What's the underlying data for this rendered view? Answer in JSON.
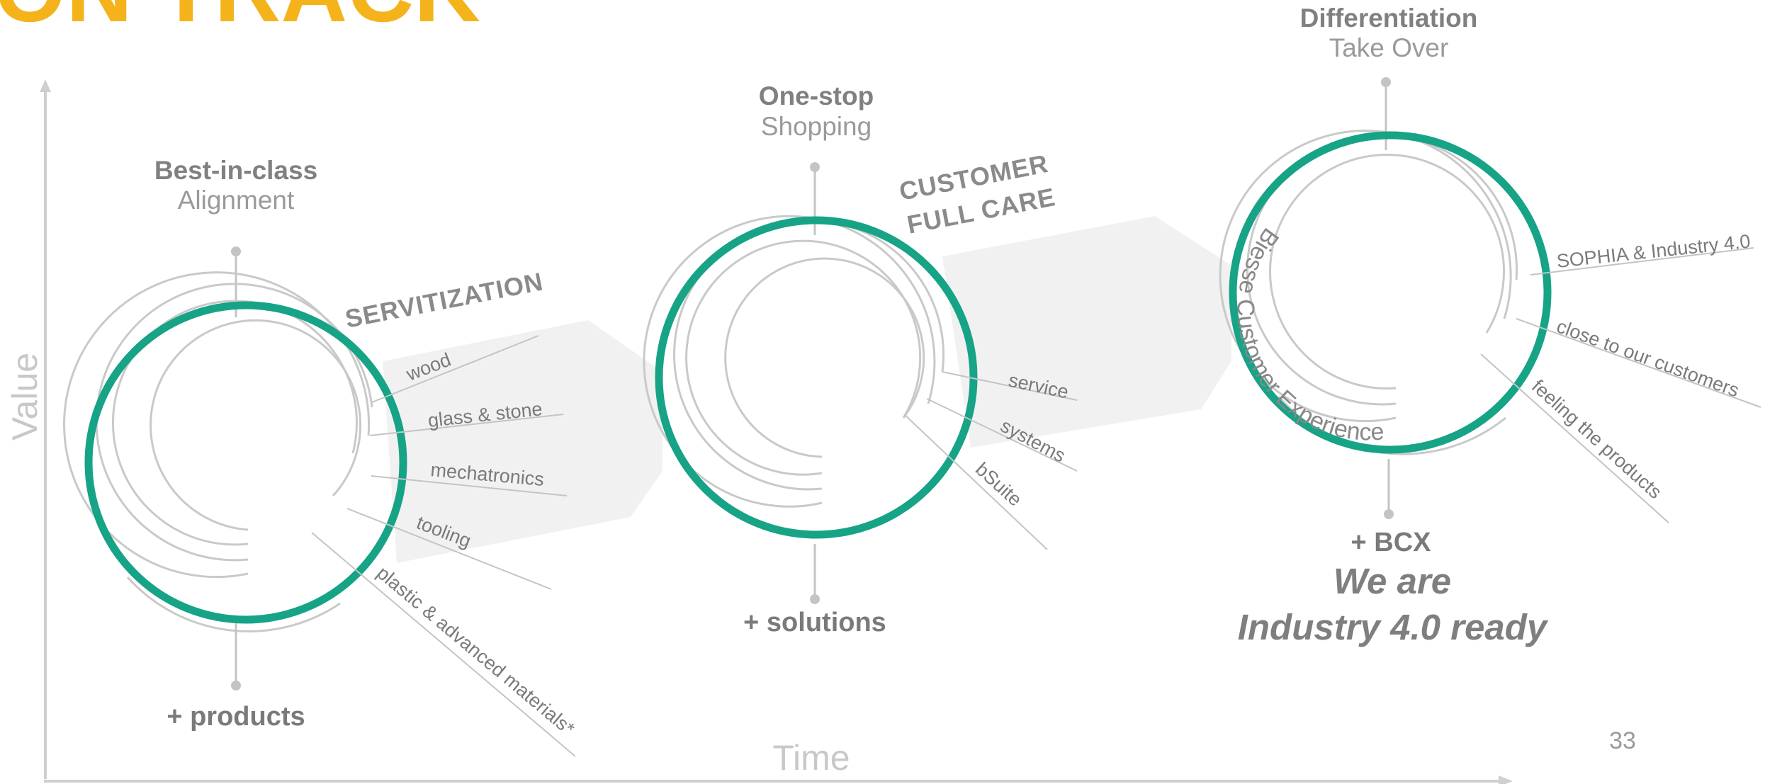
{
  "title": "ON TRACK",
  "axes": {
    "y_label": "Value",
    "x_label": "Time"
  },
  "page_number": "33",
  "colors": {
    "ring": "#17a385",
    "accent": "#f5b31b",
    "text": "#808080",
    "band": "#f0f0f0"
  },
  "stages": [
    {
      "top_bold": "Best-in-class",
      "top_light": "Alignment",
      "bottom": "+ products",
      "tag_line1": "SERVITIZATION",
      "tag_line2": "",
      "branches": [
        "wood",
        "glass & stone",
        "mechatronics",
        "tooling",
        "plastic & advanced materials*"
      ]
    },
    {
      "top_bold": "One-stop",
      "top_light": "Shopping",
      "bottom": "+ solutions",
      "tag_line1": "CUSTOMER",
      "tag_line2": "FULL CARE",
      "branches": [
        "service",
        "systems",
        "bSuite"
      ]
    },
    {
      "top_bold": "Differentiation",
      "top_light": "Take Over",
      "bottom": "+ BCX",
      "ring_text": "Biesse Customer Experience",
      "branches": [
        "SOPHIA & Industry 4.0",
        "close to our customers",
        "feeling the products"
      ]
    }
  ],
  "claim": {
    "line1": "We are",
    "line2": "Industry 4.0 ready"
  }
}
